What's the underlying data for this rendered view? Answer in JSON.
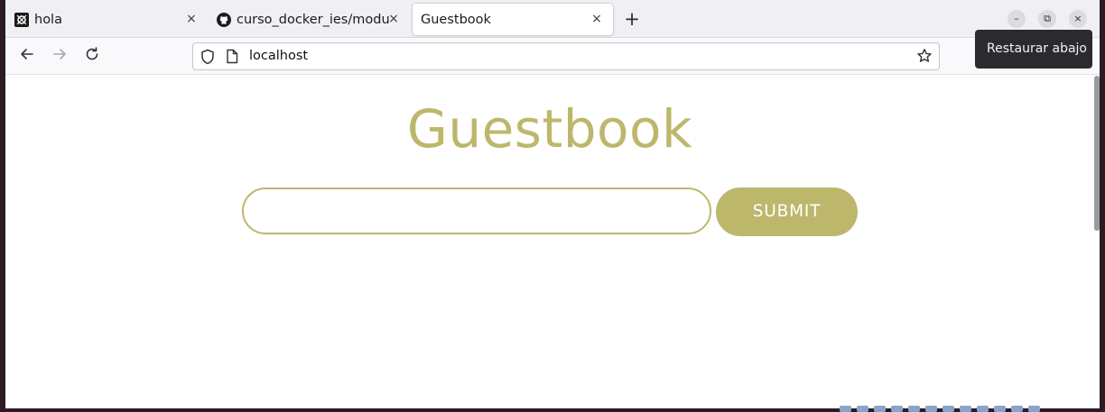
{
  "browser": {
    "tabs": [
      {
        "label": "hola",
        "icon": "app-icon",
        "active": false
      },
      {
        "label": "curso_docker_ies/modulo",
        "icon": "github-icon",
        "active": false
      },
      {
        "label": "Guestbook",
        "active": true
      }
    ],
    "tab_close_glyph": "×",
    "new_tab_glyph": "+",
    "address": "localhost",
    "tooltip": "Restaurar abajo",
    "window_controls": {
      "minimize": "–",
      "restore": "⧉",
      "close": "×"
    }
  },
  "page": {
    "title": "Guestbook",
    "input_value": "",
    "submit_label": "SUBMIT",
    "accent_color": "#bdb76b"
  }
}
